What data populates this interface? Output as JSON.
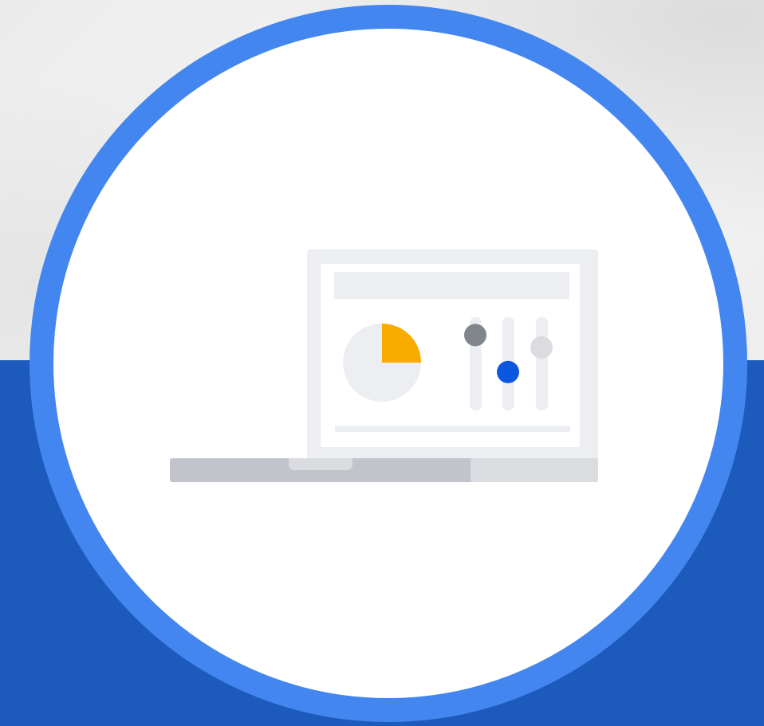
{
  "colors": {
    "background_top": "#efefef",
    "background_band": "#1c5bbb",
    "ring": "#4386ef",
    "disc": "#ffffff",
    "screen_bezel": "#eceef1",
    "screen_panel": "#ffffff",
    "laptop_base": "#c1c5cb",
    "laptop_base_light": "#dadce0",
    "pie_base": "#eceef1",
    "pie_slice": "#f9ab00",
    "slider_track": "#eceef1",
    "slider_knob_dark": "#80868b",
    "slider_knob_blue": "#0b57e0",
    "slider_knob_light": "#dadce0"
  },
  "illustration": {
    "name": "laptop-settings-illustration",
    "pie_fraction": 0.25,
    "sliders": [
      {
        "name": "slider-1",
        "level": 0.85,
        "knob": "slider_knob_dark"
      },
      {
        "name": "slider-2",
        "level": 0.4,
        "knob": "slider_knob_blue"
      },
      {
        "name": "slider-3",
        "level": 0.7,
        "knob": "slider_knob_light"
      }
    ]
  }
}
